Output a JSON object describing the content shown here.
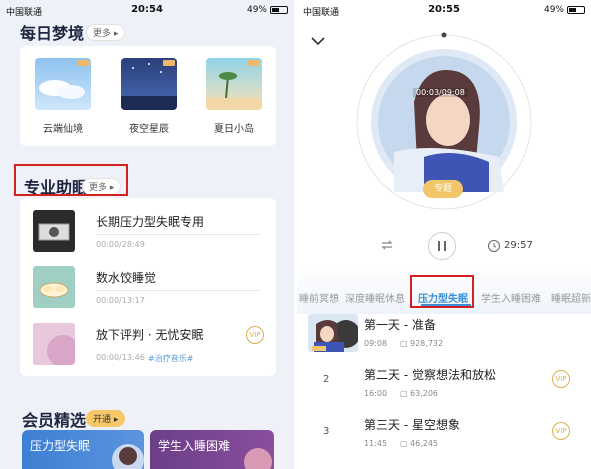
{
  "left": {
    "status": {
      "carrier": "中国联通",
      "time": "20:54",
      "battery": "49%"
    },
    "dream": {
      "title": "每日梦境",
      "more": "更多 ▸",
      "items": [
        {
          "label": "云端仙境"
        },
        {
          "label": "夜空星辰"
        },
        {
          "label": "夏日小岛"
        }
      ]
    },
    "sleep": {
      "title": "专业助眠",
      "more": "更多 ▸",
      "tracks": [
        {
          "title": "长期压力型失眠专用",
          "meta": "00:00/28:49",
          "tag": ""
        },
        {
          "title": "数水饺睡觉",
          "meta": "00:00/13:17",
          "tag": ""
        },
        {
          "title": "放下评判 · 无忧安眠",
          "meta": "00:00/13:46",
          "tag": "#治疗音乐#"
        }
      ]
    },
    "vip": {
      "title": "会员精选",
      "badge": "开通 ▸",
      "cards": [
        {
          "label": "压力型失眠"
        },
        {
          "label": "学生入睡困难"
        }
      ]
    }
  },
  "right": {
    "status": {
      "carrier": "中国联通",
      "time": "20:55",
      "battery": "49%"
    },
    "player": {
      "progress": "00:03/09:08",
      "topic": "专题",
      "timer": "29:57"
    },
    "tabs": [
      "睡前冥想",
      "深度睡眠休息",
      "压力型失眠",
      "学生入睡困难",
      "睡眠超新"
    ],
    "active_tab": 2,
    "list": [
      {
        "num": "",
        "title": "第一天 - 准备",
        "duration": "09:08",
        "plays": "928,732"
      },
      {
        "num": "2",
        "title": "第二天 - 觉察想法和放松",
        "duration": "16:00",
        "plays": "63,206"
      },
      {
        "num": "3",
        "title": "第三天 - 星空想象",
        "duration": "11:45",
        "plays": "46,245"
      }
    ],
    "colors": {
      "accent": "#3a8fd8",
      "highlight": "#d42020",
      "gold": "#f3c569"
    }
  }
}
